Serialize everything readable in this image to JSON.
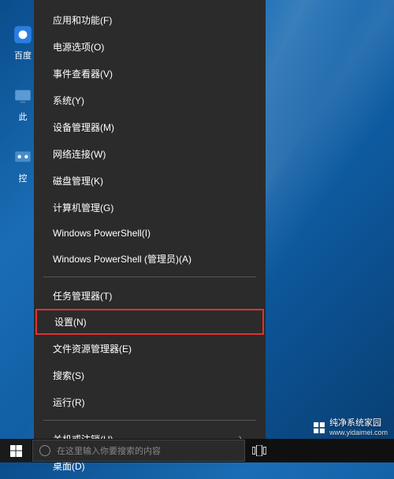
{
  "desktop": {
    "icons": [
      {
        "label": "百度",
        "color": "#2a7de1"
      },
      {
        "label": "此",
        "color": "#5a9bd5"
      },
      {
        "label": "控",
        "color": "#4a8cc7"
      }
    ]
  },
  "menu": {
    "group1": [
      {
        "label": "应用和功能(F)"
      },
      {
        "label": "电源选项(O)"
      },
      {
        "label": "事件查看器(V)"
      },
      {
        "label": "系统(Y)"
      },
      {
        "label": "设备管理器(M)"
      },
      {
        "label": "网络连接(W)"
      },
      {
        "label": "磁盘管理(K)"
      },
      {
        "label": "计算机管理(G)"
      },
      {
        "label": "Windows PowerShell(I)"
      },
      {
        "label": "Windows PowerShell (管理员)(A)"
      }
    ],
    "group2": [
      {
        "label": "任务管理器(T)"
      },
      {
        "label": "设置(N)",
        "highlighted": true
      },
      {
        "label": "文件资源管理器(E)"
      },
      {
        "label": "搜索(S)"
      },
      {
        "label": "运行(R)"
      }
    ],
    "group3": [
      {
        "label": "关机或注销(U)",
        "submenu": true
      },
      {
        "label": "桌面(D)"
      }
    ]
  },
  "taskbar": {
    "search_placeholder": "在这里输入你要搜索的内容"
  },
  "watermark": {
    "title": "纯净系统家园",
    "url": "www.yidaimei.com"
  }
}
